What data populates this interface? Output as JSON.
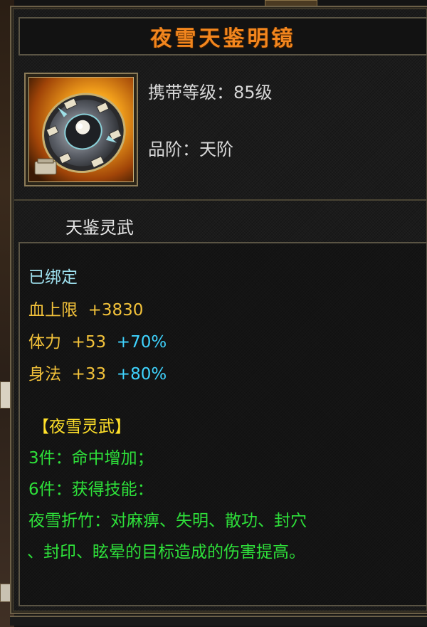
{
  "item": {
    "name": "夜雪天鉴明镜",
    "level_label": "携带等级：85级",
    "grade_label": "品阶：天阶",
    "set_name": "天鉴灵武",
    "icon": "round-mirror-shield-icon"
  },
  "stats": {
    "bound": "已绑定",
    "hp": {
      "label": "血上限",
      "value": "+3830"
    },
    "str": {
      "label": "体力",
      "value": "+53",
      "pct": "+70%"
    },
    "agi": {
      "label": "身法",
      "value": "+33",
      "pct": "+80%"
    }
  },
  "set_bonus": {
    "title": "【夜雪灵武】",
    "piece3": "3件：命中增加；",
    "piece6": "6件：获得技能：",
    "skill_line1": "夜雪折竹：对麻痹、失明、散功、封穴",
    "skill_line2": "、封印、眩晕的目标造成的伤害提高。"
  },
  "colors": {
    "title": "#f2861e",
    "stat_yellow": "#f3c23a",
    "stat_cyan": "#3fd4ff",
    "set_green": "#2ee03a",
    "bound_cyan": "#9ee0ee"
  }
}
